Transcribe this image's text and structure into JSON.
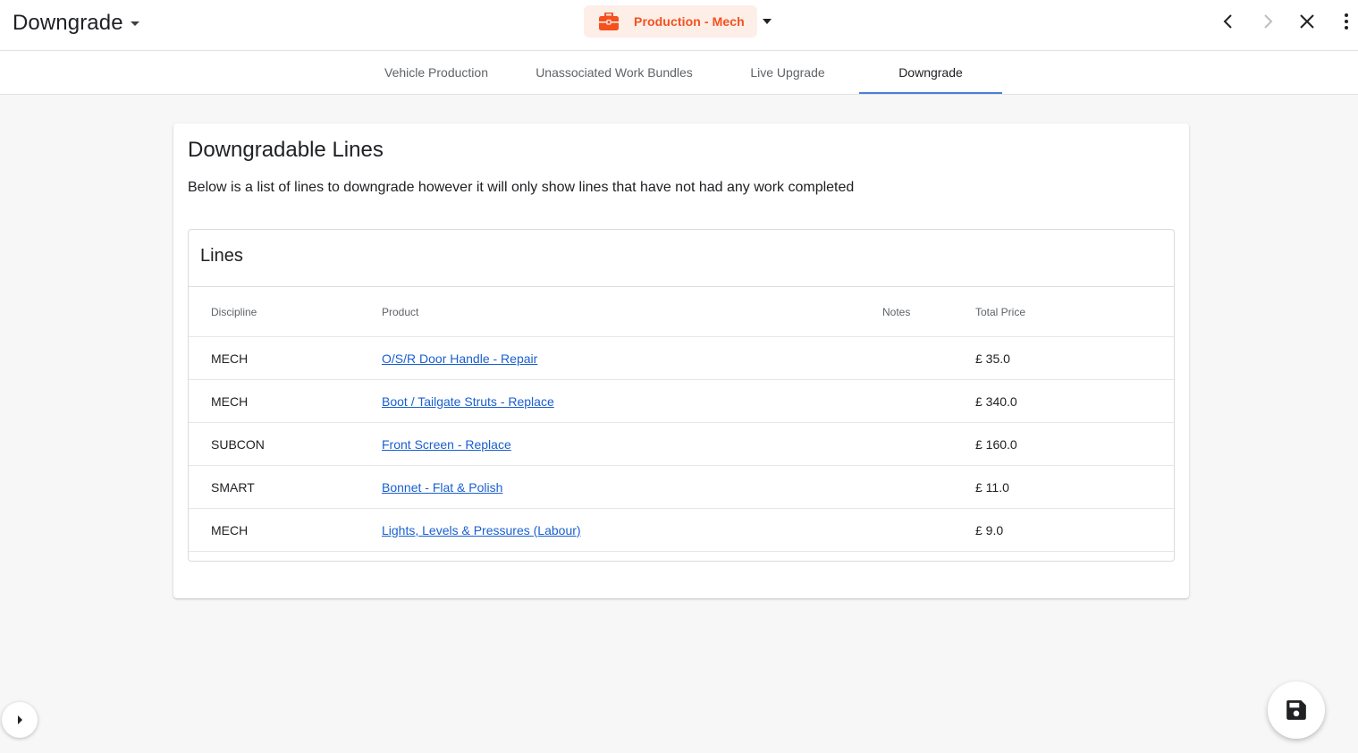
{
  "header": {
    "title": "Downgrade",
    "context_label": "Production - Mech",
    "context_icon": "briefcase-icon",
    "accent_color": "#f4511e"
  },
  "tabs": [
    {
      "label": "Vehicle Production",
      "active": false
    },
    {
      "label": "Unassociated Work Bundles",
      "active": false
    },
    {
      "label": "Live Upgrade",
      "active": false
    },
    {
      "label": "Downgrade",
      "active": true
    }
  ],
  "card": {
    "title": "Downgradable Lines",
    "description": "Below is a list of lines to downgrade however it will only show lines that have not had any work completed",
    "lines": {
      "title": "Lines",
      "columns": [
        "Discipline",
        "Product",
        "Notes",
        "Total Price"
      ],
      "rows": [
        {
          "discipline": "MECH",
          "product": "O/S/R Door Handle - Repair",
          "notes": "",
          "total_price": "£ 35.0"
        },
        {
          "discipline": "MECH",
          "product": "Boot / Tailgate Struts - Replace",
          "notes": "",
          "total_price": "£ 340.0"
        },
        {
          "discipline": "SUBCON",
          "product": "Front Screen - Replace",
          "notes": "",
          "total_price": "£ 160.0"
        },
        {
          "discipline": "SMART",
          "product": "Bonnet - Flat & Polish",
          "notes": "",
          "total_price": "£ 11.0"
        },
        {
          "discipline": "MECH",
          "product": "Lights, Levels & Pressures (Labour)",
          "notes": "",
          "total_price": "£ 9.0"
        }
      ]
    }
  },
  "icons": {
    "back": "chevron-left-icon",
    "forward": "chevron-right-icon",
    "close": "close-icon",
    "menu": "more-vert-icon",
    "save": "save-icon",
    "sidebar": "chevron-right-icon"
  }
}
